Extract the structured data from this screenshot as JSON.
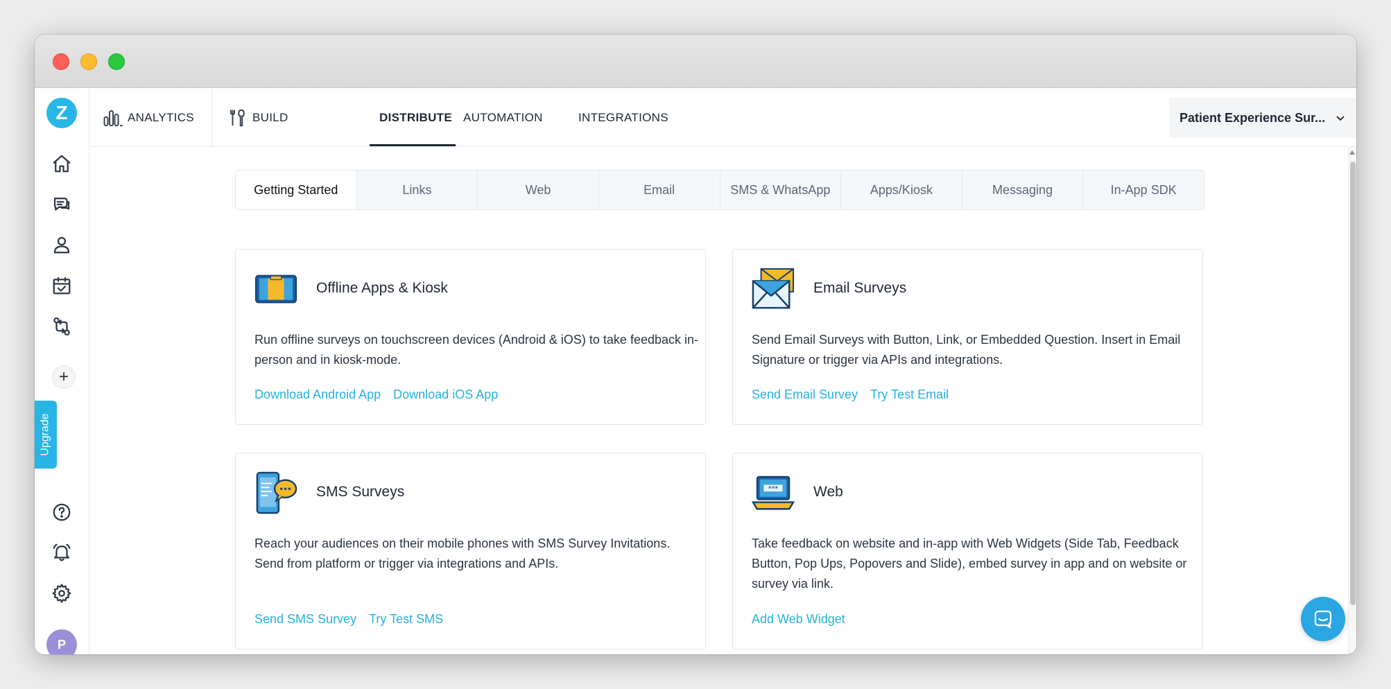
{
  "app": {
    "logo_letter": "Z",
    "upgrade_label": "Upgrade",
    "avatar_initial": "P",
    "brand_color": "#27b6e6",
    "link_color": "#26b0e0"
  },
  "topnav": {
    "analytics": "ANALYTICS",
    "build": "BUILD",
    "distribute": "DISTRIBUTE",
    "automation": "AUTOMATION",
    "integrations": "INTEGRATIONS",
    "survey_name": "Patient Experience Sur..."
  },
  "tabs": [
    {
      "label": "Getting Started",
      "active": true
    },
    {
      "label": "Links"
    },
    {
      "label": "Web"
    },
    {
      "label": "Email"
    },
    {
      "label": "SMS & WhatsApp"
    },
    {
      "label": "Apps/Kiosk"
    },
    {
      "label": "Messaging"
    },
    {
      "label": "In-App SDK"
    }
  ],
  "cards": [
    {
      "title": "Offline Apps & Kiosk",
      "icon": "kiosk-tablet-icon",
      "description": "Run offline surveys on touchscreen devices (Android & iOS) to take feedback in-person and in kiosk-mode.",
      "links": [
        "Download Android App",
        "Download iOS App"
      ]
    },
    {
      "title": "Email Surveys",
      "icon": "envelope-icon",
      "description": "Send Email Surveys with Button, Link, or Embedded Question. Insert in Email Signature or trigger via APIs and integrations.",
      "links": [
        "Send Email Survey",
        "Try Test Email"
      ]
    },
    {
      "title": "SMS Surveys",
      "icon": "phone-chat-icon",
      "description": "Reach your audiences on their mobile phones with SMS Survey Invitations. Send from platform or trigger via integrations and APIs.",
      "links": [
        "Send SMS Survey",
        "Try Test SMS"
      ]
    },
    {
      "title": "Web",
      "icon": "laptop-icon",
      "description": "Take feedback on website and in-app with Web Widgets (Side Tab, Feedback Button, Pop Ups, Popovers and Slide), embed survey in app and on website or survey via link.",
      "links": [
        "Add Web Widget"
      ]
    }
  ]
}
